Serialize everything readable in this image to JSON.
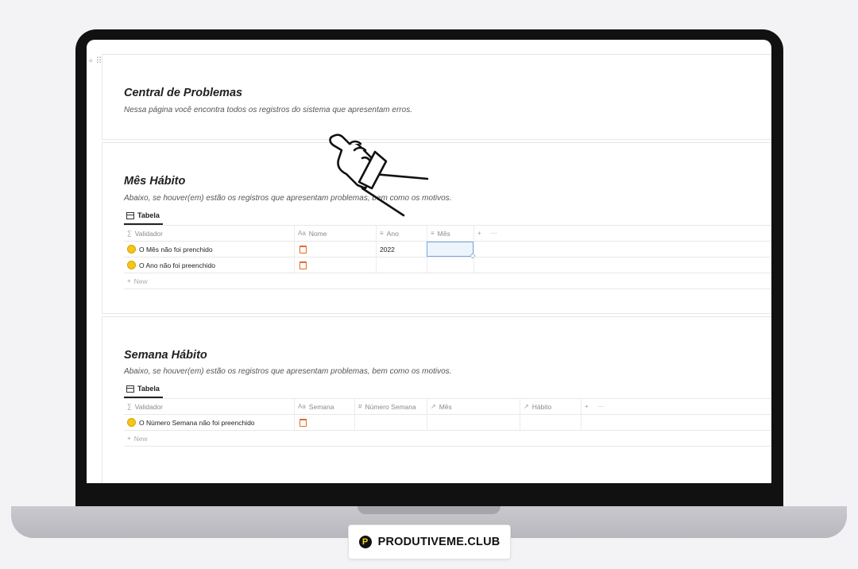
{
  "blocks": {
    "header": {
      "title": "Central de Problemas",
      "subtitle": "Nessa página você encontra todos os registros do sistema que apresentam erros."
    },
    "mes": {
      "title": "Mês Hábito",
      "subtitle": "Abaixo, se houver(em) estão os registros que apresentam problemas, bem como os motivos.",
      "view_tab": "Tabela",
      "columns": [
        "Validador",
        "Nome",
        "Ano",
        "Mês"
      ],
      "rows": [
        {
          "validador": "O Mês não foi prenchido",
          "ano": "2022"
        },
        {
          "validador": "O Ano não foi preenchido",
          "ano": ""
        }
      ],
      "new_label": "New",
      "add_col": "+",
      "more": "···"
    },
    "semana": {
      "title": "Semana Hábito",
      "subtitle": "Abaixo, se houver(em) estão os registros que apresentam problemas, bem como os motivos.",
      "view_tab": "Tabela",
      "columns": [
        "Validador",
        "Semana",
        "Número Semana",
        "Mês",
        "Hábito"
      ],
      "rows": [
        {
          "validador": "O Número Semana não foi preenchido"
        }
      ],
      "new_label": "New",
      "add_col": "+",
      "more": "···"
    }
  },
  "brand": {
    "logo_letter": "P",
    "name": "PRODUTIVEME.CLUB"
  },
  "icons": {
    "validador": "sigma-icon",
    "nome": "text-aa-icon",
    "ano": "list-lines-icon",
    "numero": "hash-icon",
    "relation": "arrow-upright-icon",
    "calendar": "calendar-icon",
    "status": "yellow-circle-icon"
  },
  "colors": {
    "accent_calendar": "#e06a2c",
    "status_dot": "#f5c518",
    "selection": "#7aa7e0"
  }
}
